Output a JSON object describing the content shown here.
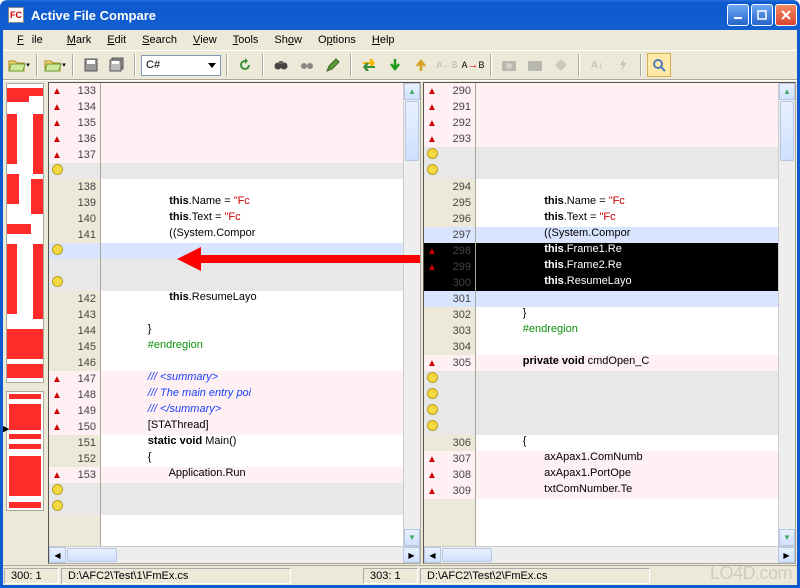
{
  "window": {
    "title": "Active File Compare",
    "app_icon_text": "FC"
  },
  "menu": {
    "items": [
      "File",
      "Mark",
      "Edit",
      "Search",
      "View",
      "Tools",
      "Show",
      "Options",
      "Help"
    ]
  },
  "toolbar": {
    "language": "C#"
  },
  "status": {
    "left_pos": "300: 1",
    "left_path": "D:\\AFC2\\Test\\1\\FmEx.cs",
    "right_pos": "303: 1",
    "right_path": "D:\\AFC2\\Test\\2\\FmEx.cs"
  },
  "left_pane": {
    "lines": [
      {
        "no": "133",
        "ico": "tri",
        "bg": "pink",
        "txt": ""
      },
      {
        "no": "134",
        "ico": "tri",
        "bg": "pink",
        "txt": ""
      },
      {
        "no": "135",
        "ico": "tri",
        "bg": "pink",
        "txt": ""
      },
      {
        "no": "136",
        "ico": "tri",
        "bg": "pink",
        "txt": ""
      },
      {
        "no": "137",
        "ico": "tri",
        "bg": "pink",
        "txt": ""
      },
      {
        "no": "",
        "ico": "circ",
        "bg": "gray",
        "txt": ""
      },
      {
        "no": "138",
        "ico": "",
        "bg": "",
        "txt": ""
      },
      {
        "no": "139",
        "ico": "",
        "bg": "",
        "html": "                     <span class='kw'>this</span>.Name = <span class='str'>\"Fc</span>"
      },
      {
        "no": "140",
        "ico": "",
        "bg": "",
        "html": "                     <span class='kw'>this</span>.Text = <span class='str'>\"Fc</span>"
      },
      {
        "no": "141",
        "ico": "",
        "bg": "",
        "txt": "                     ((System.Compor"
      },
      {
        "no": "",
        "ico": "circ",
        "bg": "lblue",
        "txt": ""
      },
      {
        "no": "",
        "ico": "",
        "bg": "gray",
        "txt": ""
      },
      {
        "no": "",
        "ico": "circ",
        "bg": "gray",
        "txt": ""
      },
      {
        "no": "142",
        "ico": "",
        "bg": "",
        "html": "                     <span class='kw'>this</span>.ResumeLayo"
      },
      {
        "no": "143",
        "ico": "",
        "bg": "",
        "txt": ""
      },
      {
        "no": "144",
        "ico": "",
        "bg": "",
        "txt": "              }"
      },
      {
        "no": "145",
        "ico": "",
        "bg": "",
        "html": "              <span class='pp'>#endregion</span>"
      },
      {
        "no": "146",
        "ico": "",
        "bg": "",
        "txt": ""
      },
      {
        "no": "147",
        "ico": "tri",
        "bg": "pink",
        "html": "              <span class='cmt'>/// &lt;summary&gt;</span>"
      },
      {
        "no": "148",
        "ico": "tri",
        "bg": "pink",
        "html": "              <span class='cmt'>/// The main entry poi</span>"
      },
      {
        "no": "149",
        "ico": "tri",
        "bg": "pink",
        "html": "              <span class='cmt'>/// &lt;/summary&gt;</span>"
      },
      {
        "no": "150",
        "ico": "tri",
        "bg": "pink",
        "txt": "              [STAThread]"
      },
      {
        "no": "151",
        "ico": "",
        "bg": "",
        "html": "              <span class='kw'>static void</span> Main()"
      },
      {
        "no": "152",
        "ico": "",
        "bg": "",
        "txt": "              {"
      },
      {
        "no": "153",
        "ico": "tri",
        "bg": "pink",
        "txt": "                     Application.Run"
      },
      {
        "no": "",
        "ico": "circ",
        "bg": "gray",
        "txt": ""
      },
      {
        "no": "",
        "ico": "circ",
        "bg": "gray",
        "txt": ""
      }
    ]
  },
  "right_pane": {
    "lines": [
      {
        "no": "290",
        "ico": "tri",
        "bg": "pink",
        "txt": ""
      },
      {
        "no": "291",
        "ico": "tri",
        "bg": "pink",
        "txt": ""
      },
      {
        "no": "292",
        "ico": "tri",
        "bg": "pink",
        "txt": ""
      },
      {
        "no": "293",
        "ico": "tri",
        "bg": "pink",
        "txt": ""
      },
      {
        "no": "",
        "ico": "circ",
        "bg": "gray",
        "txt": ""
      },
      {
        "no": "",
        "ico": "circ",
        "bg": "gray",
        "txt": ""
      },
      {
        "no": "294",
        "ico": "",
        "bg": "",
        "txt": ""
      },
      {
        "no": "295",
        "ico": "",
        "bg": "",
        "html": "                     <span class='kw'>this</span>.Name = <span class='str'>\"Fc</span>"
      },
      {
        "no": "296",
        "ico": "",
        "bg": "",
        "html": "                     <span class='kw'>this</span>.Text = <span class='str'>\"Fc</span>"
      },
      {
        "no": "297",
        "ico": "",
        "bg": "lblue",
        "txt": "                     ((System.Compor"
      },
      {
        "no": "298",
        "ico": "tri",
        "bg": "black",
        "html": "                     <span class='kw'>this</span>.Frame1.Re"
      },
      {
        "no": "299",
        "ico": "tri",
        "bg": "black",
        "html": "                     <span class='kw'>this</span>.Frame2.Re"
      },
      {
        "no": "300",
        "ico": "",
        "bg": "black",
        "html": "                     <span class='kw'>this</span>.ResumeLayo"
      },
      {
        "no": "301",
        "ico": "",
        "bg": "lblue",
        "txt": ""
      },
      {
        "no": "302",
        "ico": "",
        "bg": "",
        "txt": "              }"
      },
      {
        "no": "303",
        "ico": "",
        "bg": "",
        "html": "              <span class='pp'>#endregion</span>"
      },
      {
        "no": "304",
        "ico": "",
        "bg": "",
        "txt": ""
      },
      {
        "no": "305",
        "ico": "tri",
        "bg": "pink",
        "html": "              <span class='kw'>private void</span> cmdOpen_C"
      },
      {
        "no": "",
        "ico": "circ",
        "bg": "gray",
        "txt": ""
      },
      {
        "no": "",
        "ico": "circ",
        "bg": "gray",
        "txt": ""
      },
      {
        "no": "",
        "ico": "circ",
        "bg": "gray",
        "txt": ""
      },
      {
        "no": "",
        "ico": "circ",
        "bg": "gray",
        "txt": ""
      },
      {
        "no": "306",
        "ico": "",
        "bg": "",
        "txt": "              {"
      },
      {
        "no": "307",
        "ico": "tri",
        "bg": "pink",
        "txt": "                     axApax1.ComNumb"
      },
      {
        "no": "308",
        "ico": "tri",
        "bg": "pink",
        "txt": "                     axApax1.PortOpe"
      },
      {
        "no": "309",
        "ico": "tri",
        "bg": "pink",
        "txt": "                     txtComNumber.Te"
      }
    ]
  },
  "watermark": "LO4D.com"
}
